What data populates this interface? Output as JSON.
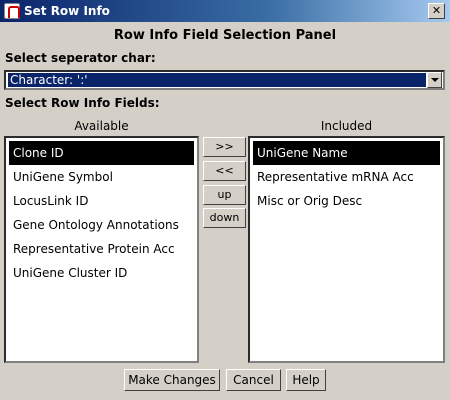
{
  "window": {
    "title": "Set Row Info"
  },
  "panel": {
    "title": "Row Info Field Selection Panel",
    "separator_label": "Select seperator char:",
    "separator_value": "Character: ':'",
    "fields_label": "Select Row Info Fields:"
  },
  "available": {
    "header": "Available",
    "items": [
      "Clone ID",
      "UniGene Symbol",
      "LocusLink ID",
      "Gene Ontology Annotations",
      "Representative Protein Acc",
      "UniGene Cluster ID"
    ],
    "selected_index": 0
  },
  "included": {
    "header": "Included",
    "items": [
      "UniGene Name",
      "Representative mRNA Acc",
      "Misc or Orig Desc"
    ],
    "selected_index": 0
  },
  "move_buttons": {
    "add": ">>",
    "remove": "<<",
    "up": "up",
    "down": "down"
  },
  "actions": {
    "make_changes": "Make Changes",
    "cancel": "Cancel",
    "help": "Help"
  }
}
